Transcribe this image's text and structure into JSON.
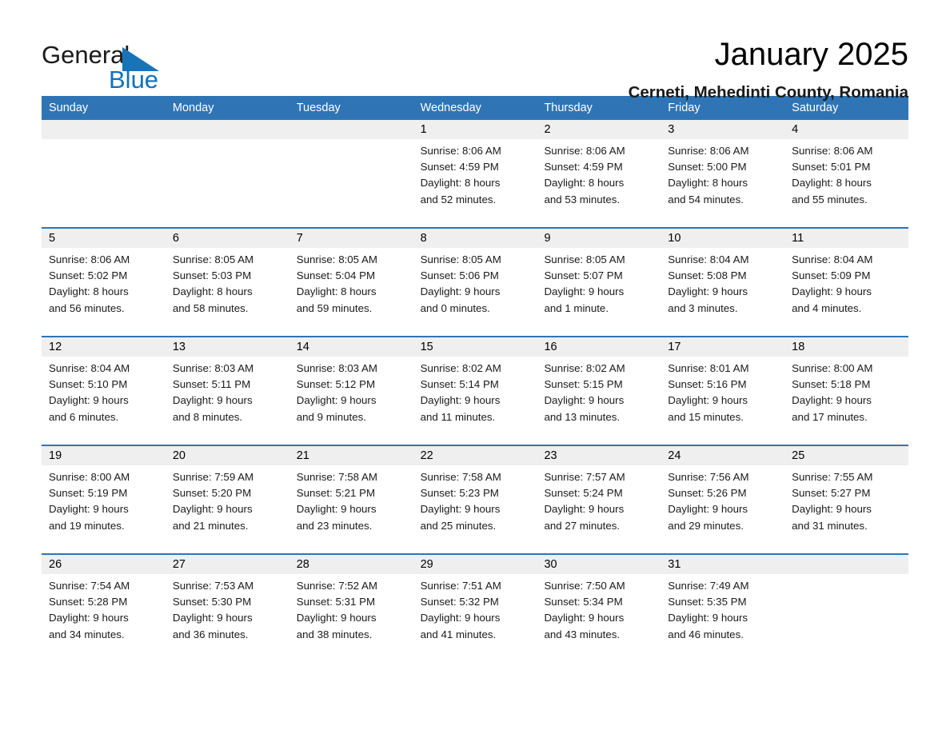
{
  "brand": {
    "line1": "General",
    "line2": "Blue",
    "triangle_color": "#1874b8",
    "blue_text_color": "#0f72bb"
  },
  "header": {
    "title": "January 2025",
    "subtitle": "Cerneti, Mehedinti County, Romania"
  },
  "theme": {
    "header_row_bg": "#2f75b5",
    "header_row_text": "#ffffff",
    "week_rule": "#2f75b5",
    "daynum_bg": "#efefef",
    "page_bg": "#ffffff"
  },
  "calendar": {
    "day_headers": [
      "Sunday",
      "Monday",
      "Tuesday",
      "Wednesday",
      "Thursday",
      "Friday",
      "Saturday"
    ],
    "weeks": [
      {
        "days": [
          {
            "num": "",
            "lines": []
          },
          {
            "num": "",
            "lines": []
          },
          {
            "num": "",
            "lines": []
          },
          {
            "num": "1",
            "lines": [
              "Sunrise: 8:06 AM",
              "Sunset: 4:59 PM",
              "Daylight: 8 hours",
              "and 52 minutes."
            ]
          },
          {
            "num": "2",
            "lines": [
              "Sunrise: 8:06 AM",
              "Sunset: 4:59 PM",
              "Daylight: 8 hours",
              "and 53 minutes."
            ]
          },
          {
            "num": "3",
            "lines": [
              "Sunrise: 8:06 AM",
              "Sunset: 5:00 PM",
              "Daylight: 8 hours",
              "and 54 minutes."
            ]
          },
          {
            "num": "4",
            "lines": [
              "Sunrise: 8:06 AM",
              "Sunset: 5:01 PM",
              "Daylight: 8 hours",
              "and 55 minutes."
            ]
          }
        ]
      },
      {
        "days": [
          {
            "num": "5",
            "lines": [
              "Sunrise: 8:06 AM",
              "Sunset: 5:02 PM",
              "Daylight: 8 hours",
              "and 56 minutes."
            ]
          },
          {
            "num": "6",
            "lines": [
              "Sunrise: 8:05 AM",
              "Sunset: 5:03 PM",
              "Daylight: 8 hours",
              "and 58 minutes."
            ]
          },
          {
            "num": "7",
            "lines": [
              "Sunrise: 8:05 AM",
              "Sunset: 5:04 PM",
              "Daylight: 8 hours",
              "and 59 minutes."
            ]
          },
          {
            "num": "8",
            "lines": [
              "Sunrise: 8:05 AM",
              "Sunset: 5:06 PM",
              "Daylight: 9 hours",
              "and 0 minutes."
            ]
          },
          {
            "num": "9",
            "lines": [
              "Sunrise: 8:05 AM",
              "Sunset: 5:07 PM",
              "Daylight: 9 hours",
              "and 1 minute."
            ]
          },
          {
            "num": "10",
            "lines": [
              "Sunrise: 8:04 AM",
              "Sunset: 5:08 PM",
              "Daylight: 9 hours",
              "and 3 minutes."
            ]
          },
          {
            "num": "11",
            "lines": [
              "Sunrise: 8:04 AM",
              "Sunset: 5:09 PM",
              "Daylight: 9 hours",
              "and 4 minutes."
            ]
          }
        ]
      },
      {
        "days": [
          {
            "num": "12",
            "lines": [
              "Sunrise: 8:04 AM",
              "Sunset: 5:10 PM",
              "Daylight: 9 hours",
              "and 6 minutes."
            ]
          },
          {
            "num": "13",
            "lines": [
              "Sunrise: 8:03 AM",
              "Sunset: 5:11 PM",
              "Daylight: 9 hours",
              "and 8 minutes."
            ]
          },
          {
            "num": "14",
            "lines": [
              "Sunrise: 8:03 AM",
              "Sunset: 5:12 PM",
              "Daylight: 9 hours",
              "and 9 minutes."
            ]
          },
          {
            "num": "15",
            "lines": [
              "Sunrise: 8:02 AM",
              "Sunset: 5:14 PM",
              "Daylight: 9 hours",
              "and 11 minutes."
            ]
          },
          {
            "num": "16",
            "lines": [
              "Sunrise: 8:02 AM",
              "Sunset: 5:15 PM",
              "Daylight: 9 hours",
              "and 13 minutes."
            ]
          },
          {
            "num": "17",
            "lines": [
              "Sunrise: 8:01 AM",
              "Sunset: 5:16 PM",
              "Daylight: 9 hours",
              "and 15 minutes."
            ]
          },
          {
            "num": "18",
            "lines": [
              "Sunrise: 8:00 AM",
              "Sunset: 5:18 PM",
              "Daylight: 9 hours",
              "and 17 minutes."
            ]
          }
        ]
      },
      {
        "days": [
          {
            "num": "19",
            "lines": [
              "Sunrise: 8:00 AM",
              "Sunset: 5:19 PM",
              "Daylight: 9 hours",
              "and 19 minutes."
            ]
          },
          {
            "num": "20",
            "lines": [
              "Sunrise: 7:59 AM",
              "Sunset: 5:20 PM",
              "Daylight: 9 hours",
              "and 21 minutes."
            ]
          },
          {
            "num": "21",
            "lines": [
              "Sunrise: 7:58 AM",
              "Sunset: 5:21 PM",
              "Daylight: 9 hours",
              "and 23 minutes."
            ]
          },
          {
            "num": "22",
            "lines": [
              "Sunrise: 7:58 AM",
              "Sunset: 5:23 PM",
              "Daylight: 9 hours",
              "and 25 minutes."
            ]
          },
          {
            "num": "23",
            "lines": [
              "Sunrise: 7:57 AM",
              "Sunset: 5:24 PM",
              "Daylight: 9 hours",
              "and 27 minutes."
            ]
          },
          {
            "num": "24",
            "lines": [
              "Sunrise: 7:56 AM",
              "Sunset: 5:26 PM",
              "Daylight: 9 hours",
              "and 29 minutes."
            ]
          },
          {
            "num": "25",
            "lines": [
              "Sunrise: 7:55 AM",
              "Sunset: 5:27 PM",
              "Daylight: 9 hours",
              "and 31 minutes."
            ]
          }
        ]
      },
      {
        "days": [
          {
            "num": "26",
            "lines": [
              "Sunrise: 7:54 AM",
              "Sunset: 5:28 PM",
              "Daylight: 9 hours",
              "and 34 minutes."
            ]
          },
          {
            "num": "27",
            "lines": [
              "Sunrise: 7:53 AM",
              "Sunset: 5:30 PM",
              "Daylight: 9 hours",
              "and 36 minutes."
            ]
          },
          {
            "num": "28",
            "lines": [
              "Sunrise: 7:52 AM",
              "Sunset: 5:31 PM",
              "Daylight: 9 hours",
              "and 38 minutes."
            ]
          },
          {
            "num": "29",
            "lines": [
              "Sunrise: 7:51 AM",
              "Sunset: 5:32 PM",
              "Daylight: 9 hours",
              "and 41 minutes."
            ]
          },
          {
            "num": "30",
            "lines": [
              "Sunrise: 7:50 AM",
              "Sunset: 5:34 PM",
              "Daylight: 9 hours",
              "and 43 minutes."
            ]
          },
          {
            "num": "31",
            "lines": [
              "Sunrise: 7:49 AM",
              "Sunset: 5:35 PM",
              "Daylight: 9 hours",
              "and 46 minutes."
            ]
          },
          {
            "num": "",
            "lines": []
          }
        ]
      }
    ]
  }
}
